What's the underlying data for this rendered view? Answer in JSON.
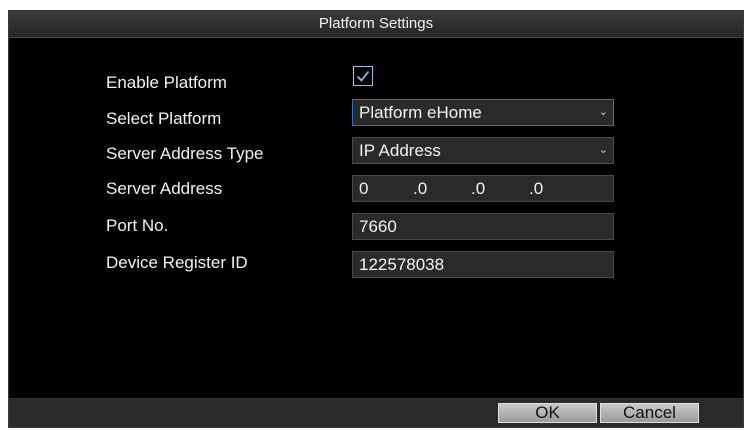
{
  "dialog": {
    "title": "Platform Settings"
  },
  "form": {
    "enable_platform": {
      "label": "Enable Platform",
      "checked": true
    },
    "select_platform": {
      "label": "Select Platform",
      "value": "Platform eHome"
    },
    "server_address_type": {
      "label": "Server Address Type",
      "value": "IP Address"
    },
    "server_address": {
      "label": "Server Address",
      "octets": [
        "0",
        ".0",
        ".0",
        ".0"
      ]
    },
    "port_no": {
      "label": "Port No.",
      "value": "7660"
    },
    "device_register_id": {
      "label": "Device Register ID",
      "value": "122578038"
    }
  },
  "footer": {
    "ok_label": "OK",
    "cancel_label": "Cancel"
  },
  "icons": {
    "checkbox": "checkmark-icon",
    "dropdown": "chevron-down-icon"
  },
  "colors": {
    "dialog_bg": "#000000",
    "field_bg": "#2a2a2a",
    "focus_border": "#2f6fcf",
    "checkbox_border": "#9ec0ea"
  }
}
